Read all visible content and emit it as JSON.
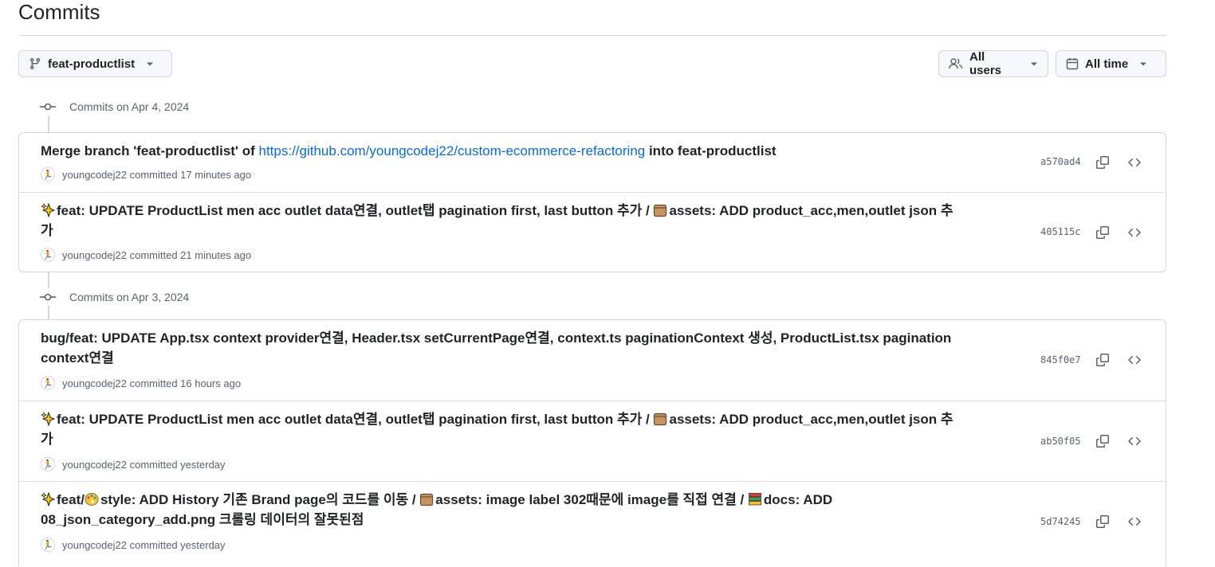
{
  "page": {
    "title": "Commits",
    "branch_button": "feat-productlist",
    "users_button": "All users",
    "time_button": "All time"
  },
  "groups": [
    {
      "header": "Commits on Apr 4, 2024",
      "commits": [
        {
          "msg_pre": "Merge branch 'feat-productlist' of ",
          "msg_link": "https://github.com/youngcodej22/custom-ecommerce-refactoring",
          "msg_post": " into feat-productlist",
          "author": "youngcodej22",
          "time": "committed 17 minutes ago",
          "sha": "a570ad4"
        },
        {
          "msg1": "feat: UPDATE ProductList men acc outlet data연결, outlet탭 pagination first, last button 추가 / ",
          "msg2": "assets: ADD product_acc,men,outlet json 추가",
          "author": "youngcodej22",
          "time": "committed 21 minutes ago",
          "sha": "405115c"
        }
      ]
    },
    {
      "header": "Commits on Apr 3, 2024",
      "commits": [
        {
          "msg": "bug/feat: UPDATE App.tsx context provider연결, Header.tsx setCurrentPage연결, context.ts paginationContext 생성, ProductList.tsx pagination context연결",
          "author": "youngcodej22",
          "time": "committed 16 hours ago",
          "sha": "845f0e7"
        },
        {
          "msg1": "feat: UPDATE ProductList men acc outlet data연결, outlet탭 pagination first, last button 추가 / ",
          "msg2": "assets: ADD product_acc,men,outlet json 추가",
          "author": "youngcodej22",
          "time": "committed yesterday",
          "sha": "ab50f05"
        },
        {
          "msg1": "feat/",
          "msg2": "style: ADD History 기존 Brand page의 코드를 이동 / ",
          "msg3": "assets: image label 302때문에 image를 직접 연결 / ",
          "msg4": "docs: ADD 08_json_category_add.png 크롤링 데이터의 잘못된점",
          "author": "youngcodej22",
          "time": "committed yesterday",
          "sha": "5d74245"
        }
      ]
    }
  ],
  "icons": {
    "branch": "git-branch-icon",
    "users": "people-icon",
    "calendar": "calendar-icon",
    "commit": "git-commit-icon",
    "copy": "copy-icon",
    "browse": "code-icon",
    "sparkles": "sparkles-emoji",
    "package": "package-emoji",
    "palette": "palette-emoji",
    "books": "books-emoji",
    "avatar": "runner-avatar"
  },
  "colors": {
    "link": "#0969da",
    "border": "#d0d7de",
    "muted": "#59636e"
  }
}
